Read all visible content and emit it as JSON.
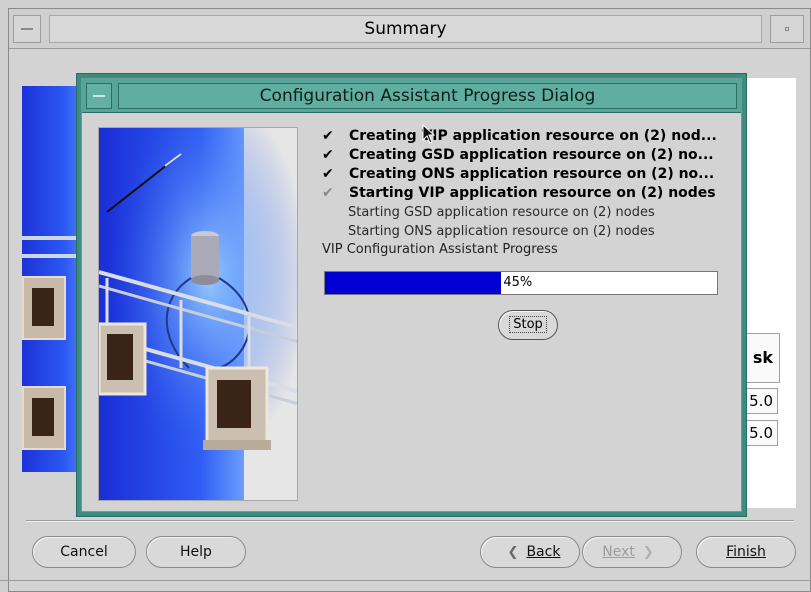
{
  "window": {
    "title": "Summary"
  },
  "background": {
    "column_header": "sk",
    "cells": [
      "5.0",
      "5.0"
    ]
  },
  "dialog": {
    "title": "Configuration Assistant Progress Dialog",
    "tasks": [
      {
        "status": "done",
        "label": "Creating VIP application resource on (2) nod..."
      },
      {
        "status": "done",
        "label": "Creating GSD application resource on (2) no..."
      },
      {
        "status": "done",
        "label": "Creating ONS application resource on (2) no..."
      },
      {
        "status": "in-progress",
        "label": "Starting VIP application resource on (2) nodes"
      },
      {
        "status": "pending",
        "label": "Starting GSD application resource on (2) nodes"
      },
      {
        "status": "pending",
        "label": "Starting ONS application resource on (2) nodes"
      }
    ],
    "check_glyph": "✔",
    "progress": {
      "label": "VIP Configuration Assistant Progress",
      "value": 45,
      "text": "45%",
      "fill_color": "#0000d2"
    },
    "stop_label": "Stop"
  },
  "navigation": {
    "cancel": "Cancel",
    "help": "Help",
    "back": "Back",
    "next": "Next",
    "finish": "Finish",
    "back_arrow": "❮",
    "next_arrow": "❯"
  },
  "icons": {
    "window_menu": "window-menu-icon",
    "minimize": "minimize-icon",
    "check": "check-icon",
    "cursor": "mouse-cursor-icon"
  }
}
